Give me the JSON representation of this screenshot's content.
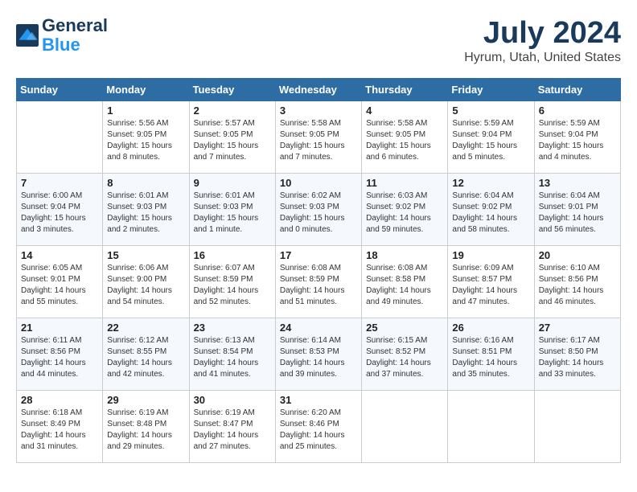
{
  "header": {
    "logo_line1": "General",
    "logo_line2": "Blue",
    "month_title": "July 2024",
    "location": "Hyrum, Utah, United States"
  },
  "weekdays": [
    "Sunday",
    "Monday",
    "Tuesday",
    "Wednesday",
    "Thursday",
    "Friday",
    "Saturday"
  ],
  "weeks": [
    [
      {
        "day": "",
        "sunrise": "",
        "sunset": "",
        "daylight": ""
      },
      {
        "day": "1",
        "sunrise": "Sunrise: 5:56 AM",
        "sunset": "Sunset: 9:05 PM",
        "daylight": "Daylight: 15 hours and 8 minutes."
      },
      {
        "day": "2",
        "sunrise": "Sunrise: 5:57 AM",
        "sunset": "Sunset: 9:05 PM",
        "daylight": "Daylight: 15 hours and 7 minutes."
      },
      {
        "day": "3",
        "sunrise": "Sunrise: 5:58 AM",
        "sunset": "Sunset: 9:05 PM",
        "daylight": "Daylight: 15 hours and 7 minutes."
      },
      {
        "day": "4",
        "sunrise": "Sunrise: 5:58 AM",
        "sunset": "Sunset: 9:05 PM",
        "daylight": "Daylight: 15 hours and 6 minutes."
      },
      {
        "day": "5",
        "sunrise": "Sunrise: 5:59 AM",
        "sunset": "Sunset: 9:04 PM",
        "daylight": "Daylight: 15 hours and 5 minutes."
      },
      {
        "day": "6",
        "sunrise": "Sunrise: 5:59 AM",
        "sunset": "Sunset: 9:04 PM",
        "daylight": "Daylight: 15 hours and 4 minutes."
      }
    ],
    [
      {
        "day": "7",
        "sunrise": "Sunrise: 6:00 AM",
        "sunset": "Sunset: 9:04 PM",
        "daylight": "Daylight: 15 hours and 3 minutes."
      },
      {
        "day": "8",
        "sunrise": "Sunrise: 6:01 AM",
        "sunset": "Sunset: 9:03 PM",
        "daylight": "Daylight: 15 hours and 2 minutes."
      },
      {
        "day": "9",
        "sunrise": "Sunrise: 6:01 AM",
        "sunset": "Sunset: 9:03 PM",
        "daylight": "Daylight: 15 hours and 1 minute."
      },
      {
        "day": "10",
        "sunrise": "Sunrise: 6:02 AM",
        "sunset": "Sunset: 9:03 PM",
        "daylight": "Daylight: 15 hours and 0 minutes."
      },
      {
        "day": "11",
        "sunrise": "Sunrise: 6:03 AM",
        "sunset": "Sunset: 9:02 PM",
        "daylight": "Daylight: 14 hours and 59 minutes."
      },
      {
        "day": "12",
        "sunrise": "Sunrise: 6:04 AM",
        "sunset": "Sunset: 9:02 PM",
        "daylight": "Daylight: 14 hours and 58 minutes."
      },
      {
        "day": "13",
        "sunrise": "Sunrise: 6:04 AM",
        "sunset": "Sunset: 9:01 PM",
        "daylight": "Daylight: 14 hours and 56 minutes."
      }
    ],
    [
      {
        "day": "14",
        "sunrise": "Sunrise: 6:05 AM",
        "sunset": "Sunset: 9:01 PM",
        "daylight": "Daylight: 14 hours and 55 minutes."
      },
      {
        "day": "15",
        "sunrise": "Sunrise: 6:06 AM",
        "sunset": "Sunset: 9:00 PM",
        "daylight": "Daylight: 14 hours and 54 minutes."
      },
      {
        "day": "16",
        "sunrise": "Sunrise: 6:07 AM",
        "sunset": "Sunset: 8:59 PM",
        "daylight": "Daylight: 14 hours and 52 minutes."
      },
      {
        "day": "17",
        "sunrise": "Sunrise: 6:08 AM",
        "sunset": "Sunset: 8:59 PM",
        "daylight": "Daylight: 14 hours and 51 minutes."
      },
      {
        "day": "18",
        "sunrise": "Sunrise: 6:08 AM",
        "sunset": "Sunset: 8:58 PM",
        "daylight": "Daylight: 14 hours and 49 minutes."
      },
      {
        "day": "19",
        "sunrise": "Sunrise: 6:09 AM",
        "sunset": "Sunset: 8:57 PM",
        "daylight": "Daylight: 14 hours and 47 minutes."
      },
      {
        "day": "20",
        "sunrise": "Sunrise: 6:10 AM",
        "sunset": "Sunset: 8:56 PM",
        "daylight": "Daylight: 14 hours and 46 minutes."
      }
    ],
    [
      {
        "day": "21",
        "sunrise": "Sunrise: 6:11 AM",
        "sunset": "Sunset: 8:56 PM",
        "daylight": "Daylight: 14 hours and 44 minutes."
      },
      {
        "day": "22",
        "sunrise": "Sunrise: 6:12 AM",
        "sunset": "Sunset: 8:55 PM",
        "daylight": "Daylight: 14 hours and 42 minutes."
      },
      {
        "day": "23",
        "sunrise": "Sunrise: 6:13 AM",
        "sunset": "Sunset: 8:54 PM",
        "daylight": "Daylight: 14 hours and 41 minutes."
      },
      {
        "day": "24",
        "sunrise": "Sunrise: 6:14 AM",
        "sunset": "Sunset: 8:53 PM",
        "daylight": "Daylight: 14 hours and 39 minutes."
      },
      {
        "day": "25",
        "sunrise": "Sunrise: 6:15 AM",
        "sunset": "Sunset: 8:52 PM",
        "daylight": "Daylight: 14 hours and 37 minutes."
      },
      {
        "day": "26",
        "sunrise": "Sunrise: 6:16 AM",
        "sunset": "Sunset: 8:51 PM",
        "daylight": "Daylight: 14 hours and 35 minutes."
      },
      {
        "day": "27",
        "sunrise": "Sunrise: 6:17 AM",
        "sunset": "Sunset: 8:50 PM",
        "daylight": "Daylight: 14 hours and 33 minutes."
      }
    ],
    [
      {
        "day": "28",
        "sunrise": "Sunrise: 6:18 AM",
        "sunset": "Sunset: 8:49 PM",
        "daylight": "Daylight: 14 hours and 31 minutes."
      },
      {
        "day": "29",
        "sunrise": "Sunrise: 6:19 AM",
        "sunset": "Sunset: 8:48 PM",
        "daylight": "Daylight: 14 hours and 29 minutes."
      },
      {
        "day": "30",
        "sunrise": "Sunrise: 6:19 AM",
        "sunset": "Sunset: 8:47 PM",
        "daylight": "Daylight: 14 hours and 27 minutes."
      },
      {
        "day": "31",
        "sunrise": "Sunrise: 6:20 AM",
        "sunset": "Sunset: 8:46 PM",
        "daylight": "Daylight: 14 hours and 25 minutes."
      },
      {
        "day": "",
        "sunrise": "",
        "sunset": "",
        "daylight": ""
      },
      {
        "day": "",
        "sunrise": "",
        "sunset": "",
        "daylight": ""
      },
      {
        "day": "",
        "sunrise": "",
        "sunset": "",
        "daylight": ""
      }
    ]
  ]
}
